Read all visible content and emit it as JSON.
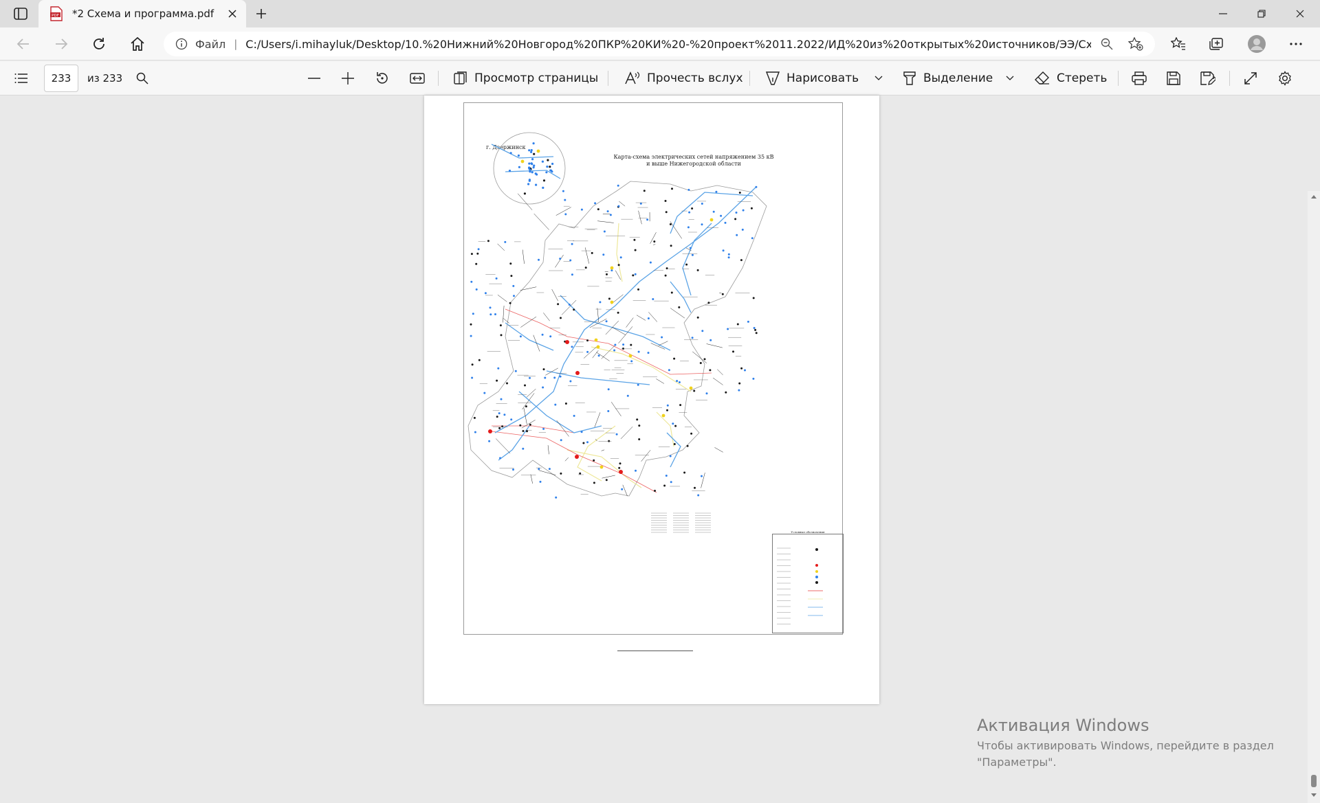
{
  "browser": {
    "tab_title": "*2 Схема и программа.pdf",
    "address_protocol": "Файл",
    "address_url": "C:/Users/i.mihayluk/Desktop/10.%20Нижний%20Новгород%20ПКР%20КИ%20-%20проект%2011.2022/ИД%20из%20открытых%20источников/ЭЭ/Схема..."
  },
  "pdf_toolbar": {
    "page_current": "233",
    "page_total": "из 233",
    "page_view": "Просмотр страницы",
    "read_aloud": "Прочесть вслух",
    "draw": "Нарисовать",
    "highlight": "Выделение",
    "erase": "Стереть"
  },
  "document": {
    "map_title_line1": "Карта-схема электрических сетей напряжением 35 кВ",
    "map_title_line2": "и выше Нижегородской области",
    "inset_label": "г. Дзержинск",
    "legend_title": "Условные обозначения"
  },
  "watermark": {
    "title": "Активация Windows",
    "text": "Чтобы активировать Windows, перейдите в раздел \"Параметры\"."
  },
  "colors": {
    "line_blue": "#5aa3e6",
    "line_yellow": "#eee89a",
    "line_red": "#e63a3a",
    "node_black": "#1a1a1a",
    "node_blue": "#2f80ea",
    "node_yellow": "#f1d21b",
    "node_red": "#e41b1b"
  }
}
